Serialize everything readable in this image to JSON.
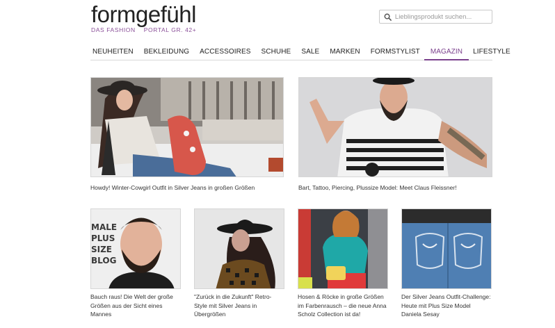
{
  "header": {
    "logo_main": "formgefühl",
    "logo_sub_left": "DAS FASHION",
    "logo_sub_right": "PORTAL GR. 42+",
    "search_placeholder": "Lieblingsprodukt suchen...",
    "search_icon": "search-icon"
  },
  "nav": {
    "items": [
      {
        "label": "NEUHEITEN"
      },
      {
        "label": "BEKLEIDUNG"
      },
      {
        "label": "ACCESSOIRES"
      },
      {
        "label": "SCHUHE"
      },
      {
        "label": "SALE"
      },
      {
        "label": "MARKEN"
      },
      {
        "label": "FORMSTYLIST"
      },
      {
        "label": "MAGAZIN"
      },
      {
        "label": "LIFESTYLE"
      }
    ],
    "active_color": "#7a3f8c"
  },
  "articles_large": [
    {
      "caption": "Howdy! Winter-Cowgirl Outfit in Silver Jeans in großen Größen"
    },
    {
      "caption": "Bart, Tattoo, Piercing, Plussize Model: Meet Claus Fleissner!"
    }
  ],
  "articles_small": [
    {
      "caption": "Bauch raus! Die Welt der große Größen aus der Sicht eines Mannes",
      "photo_text": "MALE\nPLUS\nSIZE\nBLOG"
    },
    {
      "caption": "\"Zurück in die Zukunft\" Retro-Style mit Silver Jeans in Übergrößen"
    },
    {
      "caption": "Hosen & Röcke in große Größen im Farbenrausch – die neue Anna Scholz Collection ist da!"
    },
    {
      "caption": "Der Silver Jeans Outfit-Challenge: Heute mit Plus Size Model Daniela Sesay"
    }
  ],
  "colors": {
    "brand": "#8a4f98",
    "text": "#333333"
  }
}
